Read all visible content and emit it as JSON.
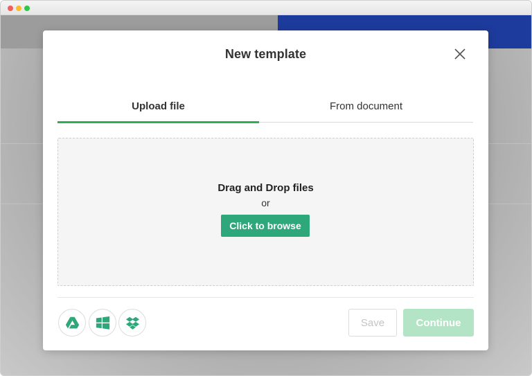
{
  "window": {
    "controls": [
      "close",
      "minimize",
      "maximize"
    ]
  },
  "modal": {
    "title": "New template",
    "close_icon": "close-icon"
  },
  "tabs": [
    {
      "label": "Upload file",
      "active": true
    },
    {
      "label": "From document",
      "active": false
    }
  ],
  "dropzone": {
    "title": "Drag and Drop files",
    "or_text": "or",
    "browse_label": "Click to browse"
  },
  "cloud_sources": [
    {
      "icon": "google-drive-icon"
    },
    {
      "icon": "windows-icon"
    },
    {
      "icon": "dropbox-icon"
    }
  ],
  "footer": {
    "save_label": "Save",
    "continue_label": "Continue"
  },
  "colors": {
    "accent_green": "#2fae55",
    "browse_button": "#2ea77a",
    "continue_disabled": "#b4e4c6",
    "background_topbar": "#1d3b9c"
  }
}
